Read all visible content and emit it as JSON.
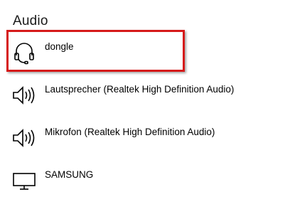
{
  "section": {
    "title": "Audio"
  },
  "devices": [
    {
      "label": "dongle",
      "icon": "headset-icon"
    },
    {
      "label": "Lautsprecher (Realtek High Definition Audio)",
      "icon": "speaker-icon"
    },
    {
      "label": "Mikrofon (Realtek High Definition Audio)",
      "icon": "speaker-icon"
    },
    {
      "label": "SAMSUNG",
      "icon": "monitor-icon"
    }
  ],
  "colors": {
    "highlight": "#d61a1a",
    "text": "#000000"
  }
}
